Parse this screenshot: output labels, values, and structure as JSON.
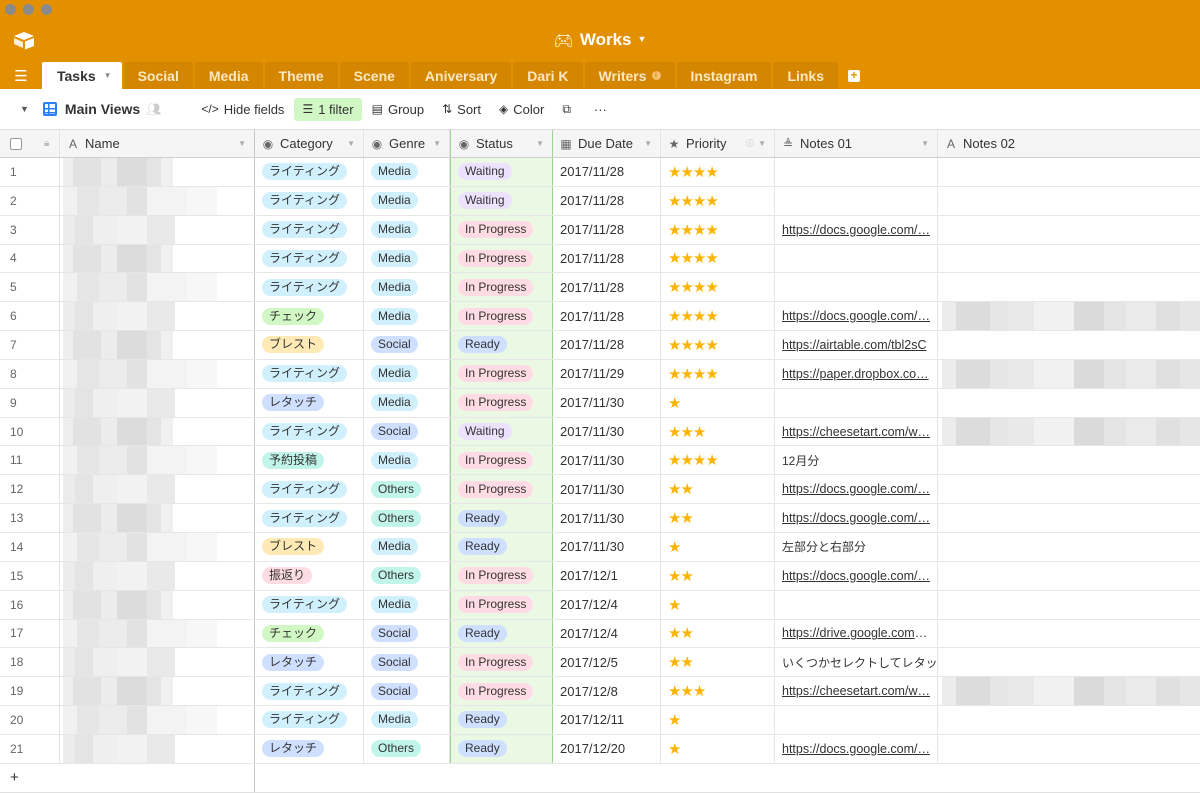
{
  "window": {
    "traffic_lights": [
      "close",
      "minimize",
      "zoom"
    ]
  },
  "base": {
    "title": "Works",
    "icon": "gamepad-icon"
  },
  "tabs": [
    {
      "label": "Tasks",
      "active": true
    },
    {
      "label": "Social"
    },
    {
      "label": "Media"
    },
    {
      "label": "Theme"
    },
    {
      "label": "Scene"
    },
    {
      "label": "Aniversary"
    },
    {
      "label": "Dari K"
    },
    {
      "label": "Writers",
      "info": true
    },
    {
      "label": "Instagram"
    },
    {
      "label": "Links"
    }
  ],
  "toolbar": {
    "view_name": "Main Views",
    "hide_fields": "Hide fields",
    "filter": "1 filter",
    "group": "Group",
    "sort": "Sort",
    "color": "Color",
    "more": "···"
  },
  "columns": {
    "name": "Name",
    "category": "Category",
    "genre": "Genre",
    "status": "Status",
    "due_date": "Due Date",
    "priority": "Priority",
    "notes01": "Notes 01",
    "notes02": "Notes 02"
  },
  "colors": {
    "brand": "#e39000",
    "tab_inactive": "#d58600",
    "filter_bg": "#d1f7c4",
    "star": "#fcb400",
    "status_col_bg": "#eaf8e4",
    "tags": {
      "ライティング": "#d0f0fd",
      "チェック": "#d1f7c4",
      "ブレスト": "#ffeab6",
      "レタッチ": "#cfdfff",
      "予約投稿": "#c2f5e9",
      "振返り": "#ffdce5",
      "Media": "#d0f0fd",
      "Social": "#cfdfff",
      "Others": "#c2f5e9",
      "Waiting": "#ede2fe",
      "In Progress": "#ffdce5",
      "Ready": "#cfdfff"
    }
  },
  "rows": [
    {
      "n": "1",
      "category": "ライティング",
      "genre": "Media",
      "status": "Waiting",
      "due": "2017/11/28",
      "priority": 4,
      "notes01": "",
      "notes01_link": false,
      "notes02_redacted": false
    },
    {
      "n": "2",
      "category": "ライティング",
      "genre": "Media",
      "status": "Waiting",
      "due": "2017/11/28",
      "priority": 4,
      "notes01": "",
      "notes01_link": false,
      "notes02_redacted": false
    },
    {
      "n": "3",
      "category": "ライティング",
      "genre": "Media",
      "status": "In Progress",
      "due": "2017/11/28",
      "priority": 4,
      "notes01": "https://docs.google.com/…",
      "notes01_link": true,
      "notes02_redacted": false
    },
    {
      "n": "4",
      "category": "ライティング",
      "genre": "Media",
      "status": "In Progress",
      "due": "2017/11/28",
      "priority": 4,
      "notes01": "",
      "notes01_link": false,
      "notes02_redacted": false
    },
    {
      "n": "5",
      "category": "ライティング",
      "genre": "Media",
      "status": "In Progress",
      "due": "2017/11/28",
      "priority": 4,
      "notes01": "",
      "notes01_link": false,
      "notes02_redacted": false
    },
    {
      "n": "6",
      "category": "チェック",
      "genre": "Media",
      "status": "In Progress",
      "due": "2017/11/28",
      "priority": 4,
      "notes01": "https://docs.google.com/…",
      "notes01_link": true,
      "notes02_redacted": true
    },
    {
      "n": "7",
      "category": "ブレスト",
      "genre": "Social",
      "status": "Ready",
      "due": "2017/11/28",
      "priority": 4,
      "notes01": "https://airtable.com/tbl2sC",
      "notes01_link": true,
      "notes02_redacted": false
    },
    {
      "n": "8",
      "category": "ライティング",
      "genre": "Media",
      "status": "In Progress",
      "due": "2017/11/29",
      "priority": 4,
      "notes01": "https://paper.dropbox.co…",
      "notes01_link": true,
      "notes02_redacted": true
    },
    {
      "n": "9",
      "category": "レタッチ",
      "genre": "Media",
      "status": "In Progress",
      "due": "2017/11/30",
      "priority": 1,
      "notes01": "",
      "notes01_link": false,
      "notes02_redacted": false
    },
    {
      "n": "10",
      "category": "ライティング",
      "genre": "Social",
      "status": "Waiting",
      "due": "2017/11/30",
      "priority": 3,
      "notes01": "https://cheesetart.com/w…",
      "notes01_link": true,
      "notes02_redacted": true
    },
    {
      "n": "11",
      "category": "予約投稿",
      "genre": "Media",
      "status": "In Progress",
      "due": "2017/11/30",
      "priority": 4,
      "notes01": "12月分",
      "notes01_link": false,
      "notes02_redacted": false
    },
    {
      "n": "12",
      "category": "ライティング",
      "genre": "Others",
      "status": "In Progress",
      "due": "2017/11/30",
      "priority": 2,
      "notes01": "https://docs.google.com/…",
      "notes01_link": true,
      "notes02_redacted": false
    },
    {
      "n": "13",
      "category": "ライティング",
      "genre": "Others",
      "status": "Ready",
      "due": "2017/11/30",
      "priority": 2,
      "notes01": "https://docs.google.com/…",
      "notes01_link": true,
      "notes02_redacted": false
    },
    {
      "n": "14",
      "category": "ブレスト",
      "genre": "Media",
      "status": "Ready",
      "due": "2017/11/30",
      "priority": 1,
      "notes01": "左部分と右部分",
      "notes01_link": false,
      "notes02_redacted": false
    },
    {
      "n": "15",
      "category": "振返り",
      "genre": "Others",
      "status": "In Progress",
      "due": "2017/12/1",
      "priority": 2,
      "notes01": "https://docs.google.com/…",
      "notes01_link": true,
      "notes02_redacted": false
    },
    {
      "n": "16",
      "category": "ライティング",
      "genre": "Media",
      "status": "In Progress",
      "due": "2017/12/4",
      "priority": 1,
      "notes01": "",
      "notes01_link": false,
      "notes02_redacted": false
    },
    {
      "n": "17",
      "category": "チェック",
      "genre": "Social",
      "status": "Ready",
      "due": "2017/12/4",
      "priority": 2,
      "notes01": "https://drive.google.com/…",
      "notes01_link": true,
      "notes02_redacted": false
    },
    {
      "n": "18",
      "category": "レタッチ",
      "genre": "Social",
      "status": "In Progress",
      "due": "2017/12/5",
      "priority": 2,
      "notes01": "いくつかセレクトしてレタッチ",
      "notes01_link": false,
      "notes02_redacted": false
    },
    {
      "n": "19",
      "category": "ライティング",
      "genre": "Social",
      "status": "In Progress",
      "due": "2017/12/8",
      "priority": 3,
      "notes01": "https://cheesetart.com/w…",
      "notes01_link": true,
      "notes02_redacted": true
    },
    {
      "n": "20",
      "category": "ライティング",
      "genre": "Media",
      "status": "Ready",
      "due": "2017/12/11",
      "priority": 1,
      "notes01": "",
      "notes01_link": false,
      "notes02_redacted": false
    },
    {
      "n": "21",
      "category": "レタッチ",
      "genre": "Others",
      "status": "Ready",
      "due": "2017/12/20",
      "priority": 1,
      "notes01": "https://docs.google.com/…",
      "notes01_link": true,
      "notes02_redacted": false
    }
  ],
  "add_row_label": "+"
}
